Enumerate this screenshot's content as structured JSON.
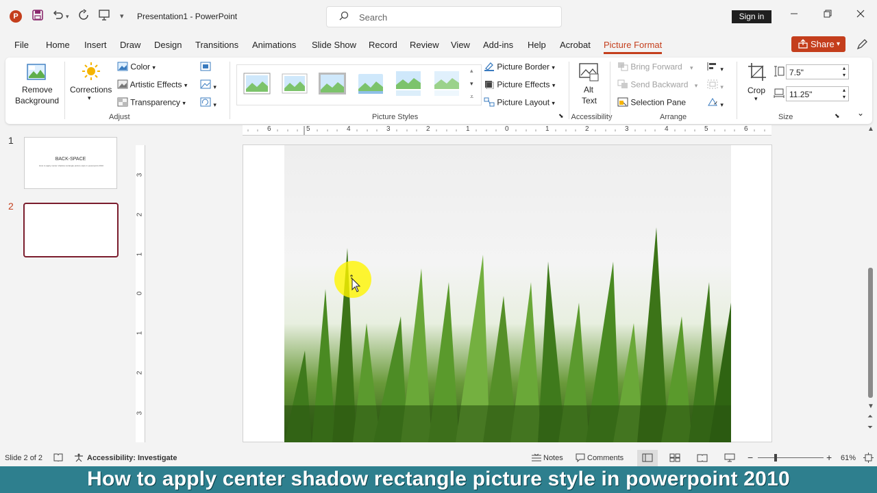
{
  "app": {
    "title": "Presentation1  -  PowerPoint",
    "search_placeholder": "Search",
    "sign_in": "Sign in",
    "accent": "#c43e1c",
    "logo_letter": "P"
  },
  "menu": {
    "tabs": [
      "File",
      "Home",
      "Insert",
      "Draw",
      "Design",
      "Transitions",
      "Animations",
      "Slide Show",
      "Record",
      "Review",
      "View",
      "Add-ins",
      "Help",
      "Acrobat",
      "Picture Format"
    ],
    "active_tab": "Picture Format",
    "share": "Share"
  },
  "ribbon": {
    "adjust": {
      "label": "Adjust",
      "remove_background": [
        "Remove",
        "Background"
      ],
      "corrections": "Corrections",
      "color": "Color",
      "artistic_effects": "Artistic Effects",
      "transparency": "Transparency"
    },
    "picture_styles": {
      "label": "Picture Styles",
      "picture_border": "Picture Border",
      "picture_effects": "Picture Effects",
      "picture_layout": "Picture Layout"
    },
    "accessibility": {
      "label": "Accessibility",
      "alt_text": [
        "Alt",
        "Text"
      ]
    },
    "arrange": {
      "label": "Arrange",
      "bring_forward": "Bring Forward",
      "send_backward": "Send Backward",
      "selection_pane": "Selection Pane"
    },
    "size": {
      "label": "Size",
      "crop": "Crop",
      "height": "7.5\"",
      "width": "11.25\""
    }
  },
  "slides": {
    "thumbs": [
      {
        "number": "1",
        "title": "BACK-SPACE",
        "subtitle": "How to apply center shadow rectangle picture style in powerpoint 2010"
      },
      {
        "number": "2"
      }
    ]
  },
  "rulers": {
    "horizontal": [
      "6",
      "5",
      "4",
      "3",
      "2",
      "1",
      "0",
      "1",
      "2",
      "3",
      "4",
      "5",
      "6"
    ],
    "vertical": [
      "3",
      "2",
      "1",
      "0",
      "1",
      "2",
      "3"
    ]
  },
  "status": {
    "slide": "Slide 2 of 2",
    "accessibility": "Accessibility: Investigate",
    "notes": "Notes",
    "comments": "Comments",
    "zoom": "61%"
  },
  "caption": "How to apply center shadow rectangle picture style in powerpoint 2010"
}
